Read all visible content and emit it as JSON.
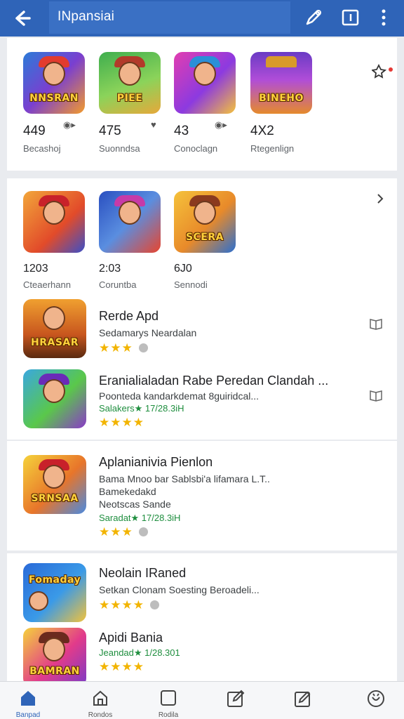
{
  "header": {
    "title": "INpansiai",
    "icons": [
      "back-arrow-icon",
      "edit-pen-icon",
      "window-icon",
      "more-vert-icon"
    ]
  },
  "top_games": [
    {
      "number": "449",
      "name": "Becashoj",
      "art_text": "NNSRAN",
      "icon": "sync-icon"
    },
    {
      "number": "475",
      "name": "Suonndsa",
      "art_text": "PIEE",
      "icon": "heart-icon"
    },
    {
      "number": "43",
      "name": "Conoclagn",
      "art_text": "",
      "icon": "sync-icon"
    },
    {
      "number": "4X2",
      "name": "Rtegenlign",
      "art_text": "BINEHO",
      "icon": "pin-icon"
    }
  ],
  "second_games": [
    {
      "number": "1203",
      "name": "Cteaerhann"
    },
    {
      "number": "2:03",
      "name": "Coruntba"
    },
    {
      "number": "6J0",
      "name": "Sennodi",
      "art_text": "SCERA"
    }
  ],
  "list": [
    {
      "title": "Rerde Apd",
      "lines": [
        "Sedamarys Neardalan"
      ],
      "green": "",
      "stars": "★★★",
      "art_text": "HRASAR"
    },
    {
      "title": "Eranialialadan Rabe Peredan Clandah ...",
      "lines": [
        "Poonteda kandarkdemat 8guiridcal..."
      ],
      "green": "Salakers★ 17/28.3iH",
      "stars": "★★★★",
      "art_text": ""
    },
    {
      "title": "Aplanianivia Pienlon",
      "lines": [
        "Bama Mnoo bar Sablsbi'a lifamara L.T..",
        "Bamekedakd",
        "Neotscas Sande"
      ],
      "green": "Saradat★ 17/28.3iH",
      "stars": "★★★",
      "art_text": "SRNSAA"
    },
    {
      "title": "Neolain IRaned",
      "lines": [
        "Setkan Clonam Soesting Beroadeli..."
      ],
      "green": "",
      "stars": "★★★★",
      "art_text": "Fomaday"
    },
    {
      "title": "Apidi Bania",
      "lines": [],
      "green": "Jeandad★ 1/28.301",
      "stars": "★★★★",
      "art_text": "BAMRAN"
    }
  ],
  "bottom_nav": [
    {
      "label": "Banpad",
      "icon": "home-icon"
    },
    {
      "label": "Rondos",
      "icon": "house-outline-icon"
    },
    {
      "label": "Rodila",
      "icon": "square-icon"
    },
    {
      "label": "",
      "icon": "edit-square-icon"
    },
    {
      "label": "",
      "icon": "compose-icon"
    },
    {
      "label": "",
      "icon": "smiley-icon"
    }
  ],
  "colors": {
    "topbar": "#2f64b8",
    "accent": "#2f64b8",
    "star": "#f2b400",
    "green_text": "#1e8e3e"
  }
}
